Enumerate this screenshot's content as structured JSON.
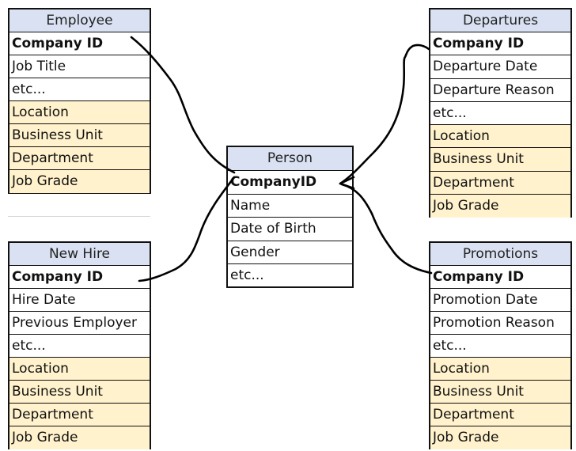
{
  "diagram": {
    "type": "entity-relationship",
    "colors": {
      "header_fill": "#d9e1f2",
      "shared_field_fill": "#fff2cc",
      "border": "#111111"
    },
    "tables": {
      "employee": {
        "title": "Employee",
        "rows": [
          {
            "label": "Company ID",
            "key": true,
            "shared": false
          },
          {
            "label": "Job Title",
            "key": false,
            "shared": false
          },
          {
            "label": "etc...",
            "key": false,
            "shared": false
          },
          {
            "label": "Location",
            "key": false,
            "shared": true
          },
          {
            "label": "Business Unit",
            "key": false,
            "shared": true
          },
          {
            "label": "Department",
            "key": false,
            "shared": true
          },
          {
            "label": "Job Grade",
            "key": false,
            "shared": true
          }
        ]
      },
      "departures": {
        "title": "Departures",
        "rows": [
          {
            "label": "Company ID",
            "key": true,
            "shared": false
          },
          {
            "label": "Departure Date",
            "key": false,
            "shared": false
          },
          {
            "label": "Departure Reason",
            "key": false,
            "shared": false
          },
          {
            "label": "etc...",
            "key": false,
            "shared": false
          },
          {
            "label": "Location",
            "key": false,
            "shared": true
          },
          {
            "label": "Business Unit",
            "key": false,
            "shared": true
          },
          {
            "label": "Department",
            "key": false,
            "shared": true
          },
          {
            "label": "Job Grade",
            "key": false,
            "shared": true
          }
        ]
      },
      "person": {
        "title": "Person",
        "rows": [
          {
            "label": "CompanyID",
            "key": true,
            "shared": false
          },
          {
            "label": "Name",
            "key": false,
            "shared": false
          },
          {
            "label": "Date of Birth",
            "key": false,
            "shared": false
          },
          {
            "label": "Gender",
            "key": false,
            "shared": false
          },
          {
            "label": "etc...",
            "key": false,
            "shared": false
          }
        ]
      },
      "newhire": {
        "title": "New Hire",
        "rows": [
          {
            "label": "Company ID",
            "key": true,
            "shared": false
          },
          {
            "label": "Hire Date",
            "key": false,
            "shared": false
          },
          {
            "label": "Previous Employer",
            "key": false,
            "shared": false
          },
          {
            "label": "etc...",
            "key": false,
            "shared": false
          },
          {
            "label": "Location",
            "key": false,
            "shared": true
          },
          {
            "label": "Business Unit",
            "key": false,
            "shared": true
          },
          {
            "label": "Department",
            "key": false,
            "shared": true
          },
          {
            "label": "Job Grade",
            "key": false,
            "shared": true
          }
        ]
      },
      "promotions": {
        "title": "Promotions",
        "rows": [
          {
            "label": "Company ID",
            "key": true,
            "shared": false
          },
          {
            "label": "Promotion Date",
            "key": false,
            "shared": false
          },
          {
            "label": "Promotion Reason",
            "key": false,
            "shared": false
          },
          {
            "label": "etc...",
            "key": false,
            "shared": false
          },
          {
            "label": "Location",
            "key": false,
            "shared": true
          },
          {
            "label": "Business Unit",
            "key": false,
            "shared": true
          },
          {
            "label": "Department",
            "key": false,
            "shared": true
          },
          {
            "label": "Job Grade",
            "key": false,
            "shared": true
          }
        ]
      }
    },
    "relationships": [
      {
        "from": "employee.Company ID",
        "to": "person.CompanyID"
      },
      {
        "from": "newhire.Company ID",
        "to": "person.CompanyID"
      },
      {
        "from": "departures.Company ID",
        "to": "person.CompanyID"
      },
      {
        "from": "promotions.Company ID",
        "to": "person.CompanyID"
      }
    ]
  }
}
